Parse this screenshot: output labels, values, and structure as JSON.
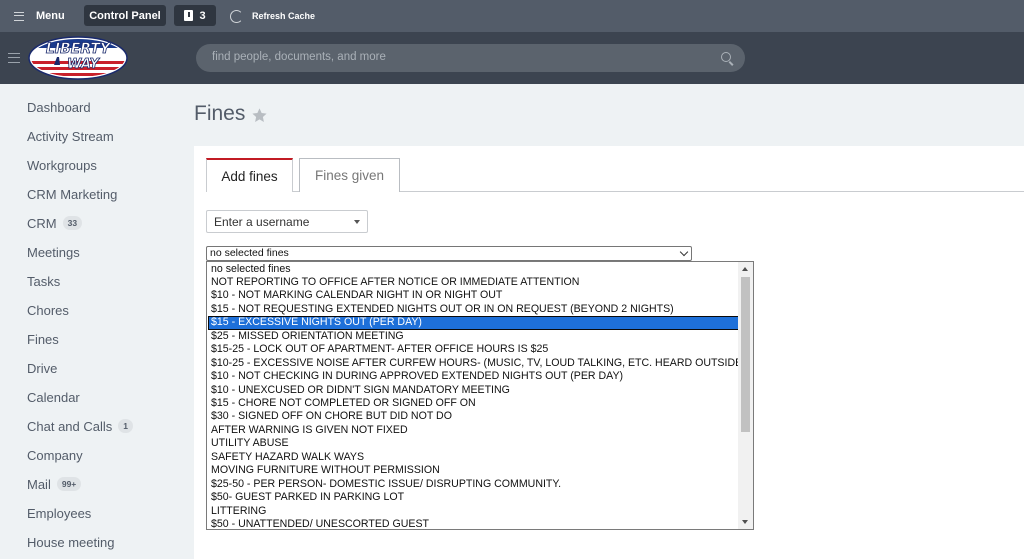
{
  "topbar": {
    "menu_label": "Menu",
    "control_panel_label": "Control Panel",
    "notification_count": "3",
    "refresh_label": "Refresh Cache"
  },
  "header": {
    "logo_text_top": "LIBERTY",
    "logo_text_bottom": "WAY",
    "search_placeholder": "find people, documents, and more"
  },
  "sidebar": {
    "items": [
      {
        "label": "Dashboard",
        "badge": ""
      },
      {
        "label": "Activity Stream",
        "badge": ""
      },
      {
        "label": "Workgroups",
        "badge": ""
      },
      {
        "label": "CRM Marketing",
        "badge": ""
      },
      {
        "label": "CRM",
        "badge": "33"
      },
      {
        "label": "Meetings",
        "badge": ""
      },
      {
        "label": "Tasks",
        "badge": ""
      },
      {
        "label": "Chores",
        "badge": ""
      },
      {
        "label": "Fines",
        "badge": ""
      },
      {
        "label": "Drive",
        "badge": ""
      },
      {
        "label": "Calendar",
        "badge": ""
      },
      {
        "label": "Chat and Calls",
        "badge": "1"
      },
      {
        "label": "Company",
        "badge": ""
      },
      {
        "label": "Mail",
        "badge": "99+"
      },
      {
        "label": "Employees",
        "badge": ""
      },
      {
        "label": "House meeting",
        "badge": ""
      }
    ]
  },
  "page": {
    "title": "Fines",
    "tabs": [
      {
        "label": "Add fines",
        "active": true
      },
      {
        "label": "Fines given",
        "active": false
      }
    ],
    "username_select": "Enter a username",
    "fines_select": "no selected fines"
  },
  "fines_options": [
    "no selected fines",
    "NOT REPORTING TO OFFICE AFTER NOTICE OR IMMEDIATE ATTENTION",
    "$10 - NOT MARKING CALENDAR NIGHT IN OR NIGHT OUT",
    "$15 - NOT REQUESTING EXTENDED NIGHTS OUT OR IN ON REQUEST (BEYOND 2 NIGHTS)",
    "$15 - EXCESSIVE NIGHTS OUT (PER DAY)",
    "$25 - MISSED ORIENTATION MEETING",
    "$15-25 - LOCK OUT OF APARTMENT- AFTER OFFICE HOURS IS $25",
    "$10-25 - EXCESSIVE NOISE AFTER CURFEW HOURS- (MUSIC, TV, LOUD TALKING, ETC. HEARD OUTSIDE",
    "$10 - NOT CHECKING IN DURING APPROVED EXTENDED NIGHTS OUT (PER DAY)",
    "$10 - UNEXCUSED OR DIDN'T SIGN MANDATORY MEETING",
    "$15 - CHORE NOT COMPLETED OR SIGNED OFF ON",
    "$30 - SIGNED OFF ON CHORE BUT DID NOT DO",
    "AFTER WARNING IS GIVEN NOT FIXED",
    "UTILITY ABUSE",
    "SAFETY HAZARD WALK WAYS",
    "MOVING FURNITURE WITHOUT PERMISSION",
    "$25-50 - PER PERSON- DOMESTIC ISSUE/ DISRUPTING COMMUNITY.",
    "$50- GUEST PARKED IN PARKING LOT",
    "LITTERING",
    "$50 - UNATTENDED/ UNESCORTED GUEST"
  ],
  "selected_option_index": 4,
  "colors": {
    "topbar": "#535c69",
    "header": "#3c4450",
    "tab_accent": "#c21b24",
    "selection": "#1e70d9"
  }
}
